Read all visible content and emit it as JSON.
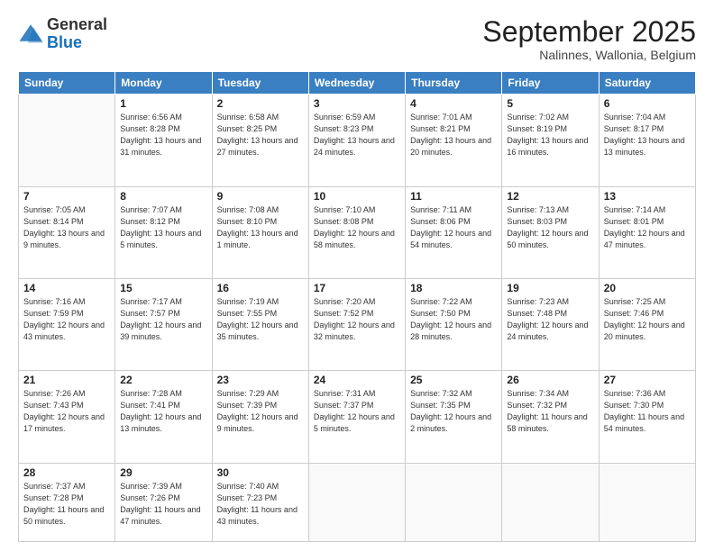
{
  "logo": {
    "general": "General",
    "blue": "Blue"
  },
  "header": {
    "month": "September 2025",
    "location": "Nalinnes, Wallonia, Belgium"
  },
  "days_of_week": [
    "Sunday",
    "Monday",
    "Tuesday",
    "Wednesday",
    "Thursday",
    "Friday",
    "Saturday"
  ],
  "weeks": [
    [
      {
        "day": "",
        "info": ""
      },
      {
        "day": "1",
        "info": "Sunrise: 6:56 AM\nSunset: 8:28 PM\nDaylight: 13 hours and 31 minutes."
      },
      {
        "day": "2",
        "info": "Sunrise: 6:58 AM\nSunset: 8:25 PM\nDaylight: 13 hours and 27 minutes."
      },
      {
        "day": "3",
        "info": "Sunrise: 6:59 AM\nSunset: 8:23 PM\nDaylight: 13 hours and 24 minutes."
      },
      {
        "day": "4",
        "info": "Sunrise: 7:01 AM\nSunset: 8:21 PM\nDaylight: 13 hours and 20 minutes."
      },
      {
        "day": "5",
        "info": "Sunrise: 7:02 AM\nSunset: 8:19 PM\nDaylight: 13 hours and 16 minutes."
      },
      {
        "day": "6",
        "info": "Sunrise: 7:04 AM\nSunset: 8:17 PM\nDaylight: 13 hours and 13 minutes."
      }
    ],
    [
      {
        "day": "7",
        "info": "Sunrise: 7:05 AM\nSunset: 8:14 PM\nDaylight: 13 hours and 9 minutes."
      },
      {
        "day": "8",
        "info": "Sunrise: 7:07 AM\nSunset: 8:12 PM\nDaylight: 13 hours and 5 minutes."
      },
      {
        "day": "9",
        "info": "Sunrise: 7:08 AM\nSunset: 8:10 PM\nDaylight: 13 hours and 1 minute."
      },
      {
        "day": "10",
        "info": "Sunrise: 7:10 AM\nSunset: 8:08 PM\nDaylight: 12 hours and 58 minutes."
      },
      {
        "day": "11",
        "info": "Sunrise: 7:11 AM\nSunset: 8:06 PM\nDaylight: 12 hours and 54 minutes."
      },
      {
        "day": "12",
        "info": "Sunrise: 7:13 AM\nSunset: 8:03 PM\nDaylight: 12 hours and 50 minutes."
      },
      {
        "day": "13",
        "info": "Sunrise: 7:14 AM\nSunset: 8:01 PM\nDaylight: 12 hours and 47 minutes."
      }
    ],
    [
      {
        "day": "14",
        "info": "Sunrise: 7:16 AM\nSunset: 7:59 PM\nDaylight: 12 hours and 43 minutes."
      },
      {
        "day": "15",
        "info": "Sunrise: 7:17 AM\nSunset: 7:57 PM\nDaylight: 12 hours and 39 minutes."
      },
      {
        "day": "16",
        "info": "Sunrise: 7:19 AM\nSunset: 7:55 PM\nDaylight: 12 hours and 35 minutes."
      },
      {
        "day": "17",
        "info": "Sunrise: 7:20 AM\nSunset: 7:52 PM\nDaylight: 12 hours and 32 minutes."
      },
      {
        "day": "18",
        "info": "Sunrise: 7:22 AM\nSunset: 7:50 PM\nDaylight: 12 hours and 28 minutes."
      },
      {
        "day": "19",
        "info": "Sunrise: 7:23 AM\nSunset: 7:48 PM\nDaylight: 12 hours and 24 minutes."
      },
      {
        "day": "20",
        "info": "Sunrise: 7:25 AM\nSunset: 7:46 PM\nDaylight: 12 hours and 20 minutes."
      }
    ],
    [
      {
        "day": "21",
        "info": "Sunrise: 7:26 AM\nSunset: 7:43 PM\nDaylight: 12 hours and 17 minutes."
      },
      {
        "day": "22",
        "info": "Sunrise: 7:28 AM\nSunset: 7:41 PM\nDaylight: 12 hours and 13 minutes."
      },
      {
        "day": "23",
        "info": "Sunrise: 7:29 AM\nSunset: 7:39 PM\nDaylight: 12 hours and 9 minutes."
      },
      {
        "day": "24",
        "info": "Sunrise: 7:31 AM\nSunset: 7:37 PM\nDaylight: 12 hours and 5 minutes."
      },
      {
        "day": "25",
        "info": "Sunrise: 7:32 AM\nSunset: 7:35 PM\nDaylight: 12 hours and 2 minutes."
      },
      {
        "day": "26",
        "info": "Sunrise: 7:34 AM\nSunset: 7:32 PM\nDaylight: 11 hours and 58 minutes."
      },
      {
        "day": "27",
        "info": "Sunrise: 7:36 AM\nSunset: 7:30 PM\nDaylight: 11 hours and 54 minutes."
      }
    ],
    [
      {
        "day": "28",
        "info": "Sunrise: 7:37 AM\nSunset: 7:28 PM\nDaylight: 11 hours and 50 minutes."
      },
      {
        "day": "29",
        "info": "Sunrise: 7:39 AM\nSunset: 7:26 PM\nDaylight: 11 hours and 47 minutes."
      },
      {
        "day": "30",
        "info": "Sunrise: 7:40 AM\nSunset: 7:23 PM\nDaylight: 11 hours and 43 minutes."
      },
      {
        "day": "",
        "info": ""
      },
      {
        "day": "",
        "info": ""
      },
      {
        "day": "",
        "info": ""
      },
      {
        "day": "",
        "info": ""
      }
    ]
  ]
}
